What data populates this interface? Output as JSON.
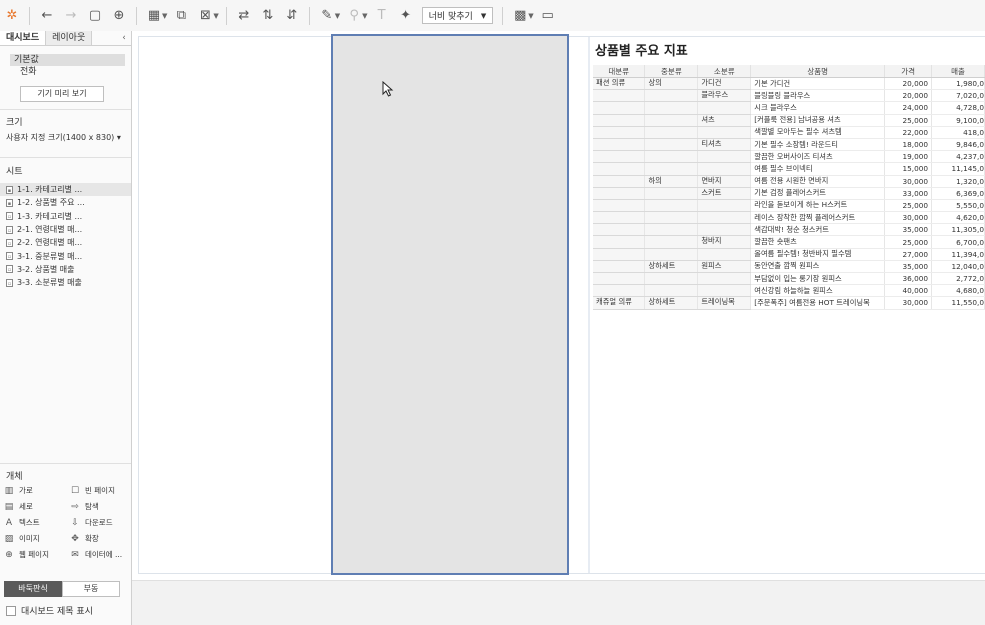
{
  "toolbar": {
    "fit_select": {
      "value": "너비 맞추기"
    },
    "icons": [
      "tableau-logo-icon",
      "undo-icon",
      "redo-icon",
      "save-icon",
      "new-datasource-icon",
      "new-sheet-icon",
      "duplicate-icon",
      "clear-icon",
      "swap-icon",
      "sort-asc-icon",
      "sort-desc-icon",
      "highlight-icon",
      "group-icon",
      "label-icon",
      "pin-icon",
      "show-cards-icon",
      "presentation-icon"
    ]
  },
  "left_panel": {
    "tabs": {
      "dashboard": "대시보드",
      "layout": "레이아웃"
    },
    "collapse": "‹",
    "device": {
      "default": "기본값",
      "phone": "전화",
      "preview_button": "기기 미리 보기"
    },
    "size": {
      "title": "크기",
      "value": "사용자 지정 크기(1400 x 830) ▾"
    },
    "sheets": {
      "title": "시트",
      "items": [
        {
          "label": "1-1. 카테고리별 ...",
          "selected": true
        },
        {
          "label": "1-2. 상품별 주요 ...",
          "selected": false
        },
        {
          "label": "1-3. 카테고리별 ...",
          "selected": false
        },
        {
          "label": "2-1. 연령대별 매...",
          "selected": false
        },
        {
          "label": "2-2. 연령대별 매...",
          "selected": false
        },
        {
          "label": "3-1. 중분류별 매...",
          "selected": false
        },
        {
          "label": "3-2. 상품별 매출",
          "selected": false
        },
        {
          "label": "3-3. 소분류별 매출",
          "selected": false
        }
      ]
    },
    "objects": {
      "title": "개체",
      "items": [
        {
          "label": "가로",
          "icon": "horizontal-icon",
          "glyph": "▥"
        },
        {
          "label": "빈 페이지",
          "icon": "blank-icon",
          "glyph": "☐"
        },
        {
          "label": "세로",
          "icon": "vertical-icon",
          "glyph": "▤"
        },
        {
          "label": "탐색",
          "icon": "navigation-icon",
          "glyph": "⇨"
        },
        {
          "label": "텍스트",
          "icon": "text-icon",
          "glyph": "A"
        },
        {
          "label": "다운로드",
          "icon": "download-icon",
          "glyph": "⇩"
        },
        {
          "label": "이미지",
          "icon": "image-icon",
          "glyph": "▨"
        },
        {
          "label": "확장",
          "icon": "extension-icon",
          "glyph": "✥"
        },
        {
          "label": "웹 페이지",
          "icon": "web-icon",
          "glyph": "⊕"
        },
        {
          "label": "데이터에 ...",
          "icon": "ask-data-icon",
          "glyph": "✉"
        }
      ]
    },
    "layout_toggle": {
      "tiled": "바둑판식",
      "floating": "부동"
    },
    "show_title": "대시보드 제목 표시"
  },
  "sheet": {
    "title": "상품별 주요 지표",
    "headers": [
      "대분류",
      "중분류",
      "소분류",
      "상품명",
      "가격",
      "매출"
    ],
    "rows": [
      [
        "패션 의류",
        "상의",
        "가디건",
        "기본 가디건",
        "20,000",
        "1,980,0"
      ],
      [
        "",
        "",
        "블라우스",
        "블링블링 블라우스",
        "20,000",
        "7,020,0"
      ],
      [
        "",
        "",
        "",
        "시크 블라우스",
        "24,000",
        "4,728,0"
      ],
      [
        "",
        "",
        "셔츠",
        "[커플룩 전용] 남녀공용 셔츠",
        "25,000",
        "9,100,0"
      ],
      [
        "",
        "",
        "",
        "색깔별 모아두는 필수 셔츠템",
        "22,000",
        "418,0"
      ],
      [
        "",
        "",
        "티셔츠",
        "기본 필수 소장템! 라운드티",
        "18,000",
        "9,846,0"
      ],
      [
        "",
        "",
        "",
        "깔끔한 오버사이즈 티셔츠",
        "19,000",
        "4,237,0"
      ],
      [
        "",
        "",
        "",
        "여름 필수 브이넥티",
        "15,000",
        "11,145,0"
      ],
      [
        "",
        "하의",
        "면바지",
        "여름 전용 시원한 면바지",
        "30,000",
        "1,320,0"
      ],
      [
        "",
        "",
        "스커트",
        "기본 검정 플레어스커트",
        "33,000",
        "6,369,0"
      ],
      [
        "",
        "",
        "",
        "라인을 돋보이게 하는 H스커트",
        "25,000",
        "5,550,0"
      ],
      [
        "",
        "",
        "",
        "레이스 장착한 깜찍 플레어스커트",
        "30,000",
        "4,620,0"
      ],
      [
        "",
        "",
        "",
        "색감대박! 청순 청스커트",
        "35,000",
        "11,305,0"
      ],
      [
        "",
        "",
        "청바지",
        "깔끔한 숏팬츠",
        "25,000",
        "6,700,0"
      ],
      [
        "",
        "",
        "",
        "올여름 필수템! 청반바지 필수템",
        "27,000",
        "11,394,0"
      ],
      [
        "",
        "상하세트",
        "원피스",
        "동안연출 깜찍 원피스",
        "35,000",
        "12,040,0"
      ],
      [
        "",
        "",
        "",
        "부담없이 입는 롱기장 원피스",
        "36,000",
        "2,772,0"
      ],
      [
        "",
        "",
        "",
        "여신강림 하늘하늘 원피스",
        "40,000",
        "4,680,0"
      ],
      [
        "캐쥬얼 의류",
        "상하세트",
        "트레이닝복",
        "[주문폭주] 여름전용 HOT 트레이닝복",
        "30,000",
        "11,550,0"
      ]
    ]
  }
}
